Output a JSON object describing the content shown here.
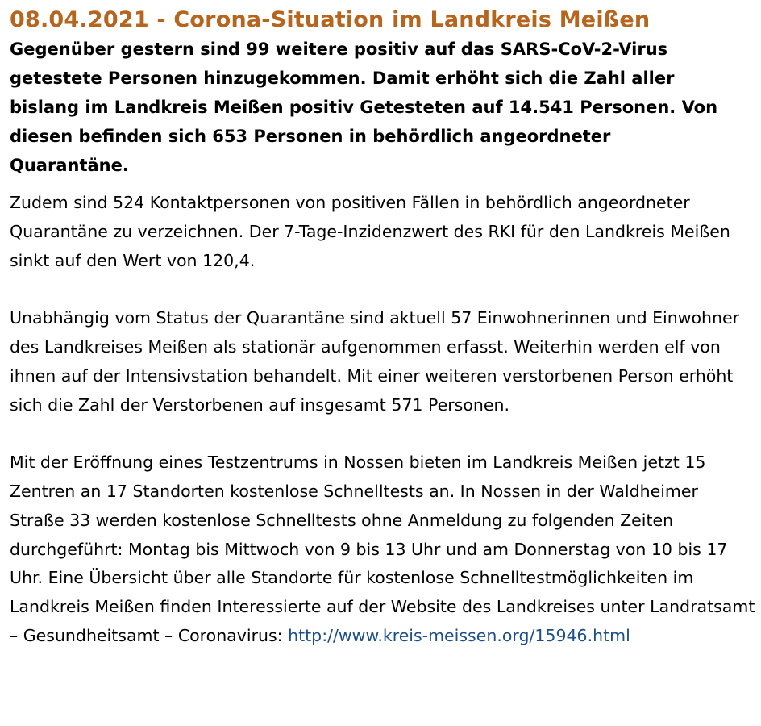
{
  "article": {
    "headline": "08.04.2021 - Corona-Situation im Landkreis Meißen",
    "lead": "Gegenüber gestern sind 99 weitere positiv auf das SARS-CoV-2-Virus getestete Personen hinzugekommen. Damit erhöht sich die Zahl aller bislang im Landkreis Meißen positiv Getesteten auf 14.541 Personen. Von diesen befinden sich 653 Personen in behördlich angeordneter Quarantäne.",
    "paragraphs": [
      "Zudem sind 524 Kontaktpersonen von positiven Fällen in behördlich angeordneter Quarantäne zu verzeichnen. Der 7-Tage-Inzidenzwert des RKI für den Landkreis Meißen sinkt auf den Wert von 120,4.",
      "Unabhängig vom Status der Quarantäne sind aktuell 57 Einwohnerinnen und Einwohner des Landkreises Meißen als stationär aufgenommen erfasst. Weiterhin werden elf von ihnen auf der Intensivstation behandelt. Mit einer weiteren verstorbenen Person erhöht sich die Zahl der Verstorbenen auf insgesamt 571 Personen.",
      "Mit der Eröffnung eines Testzentrums in Nossen bieten im Landkreis Meißen jetzt 15 Zentren an 17 Standorten kostenlose Schnelltests an. In Nossen in der Waldheimer Straße 33 werden kostenlose Schnelltests ohne Anmeldung zu folgenden Zeiten durchgeführt: Montag bis Mittwoch von 9 bis 13 Uhr und am Donnerstag von 10 bis 17 Uhr. Eine Übersicht über alle Standorte für kostenlose Schnelltestmöglichkeiten im Landkreis Meißen finden Interessierte auf der Website des Landkreises unter Landratsamt – Gesundheitsamt – Coronavirus: "
    ],
    "link_text": "http://www.kreis-meissen.org/15946.html"
  },
  "colors": {
    "headline": "#b5651d",
    "link": "#1a4f8b",
    "text": "#000000",
    "background": "#ffffff"
  }
}
